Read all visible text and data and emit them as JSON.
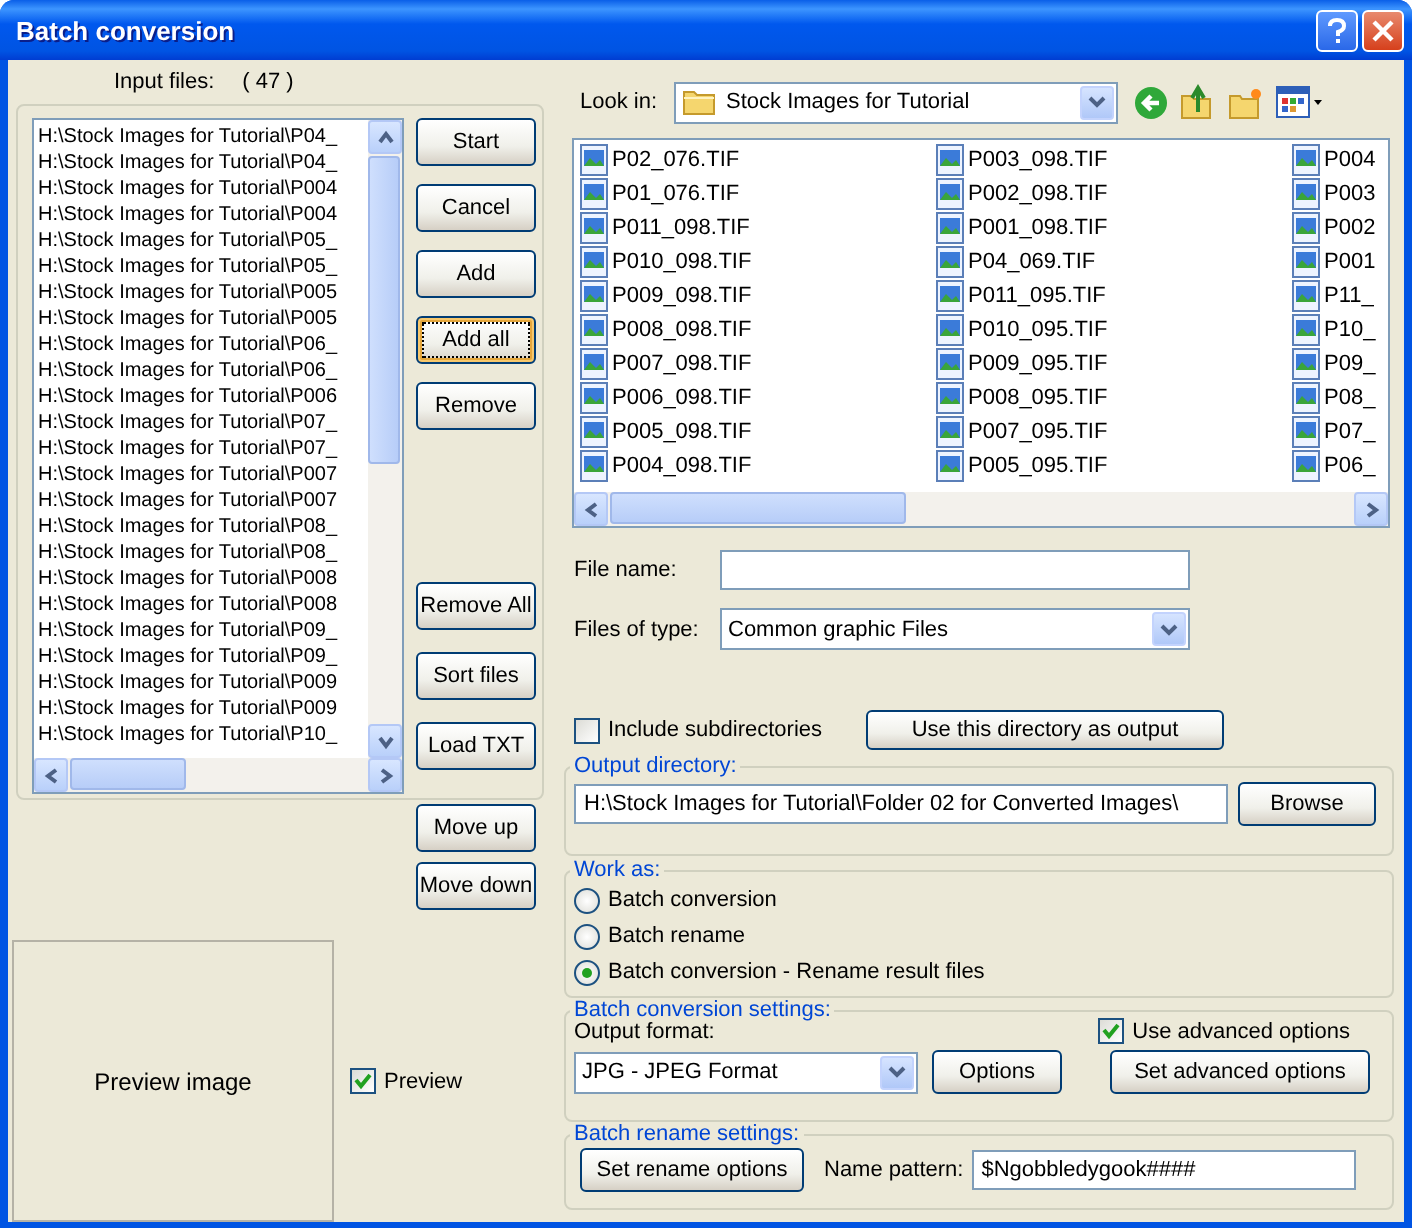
{
  "window": {
    "title": "Batch conversion"
  },
  "input_files": {
    "label": "Input files:",
    "count": "( 47 )",
    "items": [
      "H:\\Stock Images for Tutorial\\P04_",
      "H:\\Stock Images for Tutorial\\P04_",
      "H:\\Stock Images for Tutorial\\P004",
      "H:\\Stock Images for Tutorial\\P004",
      "H:\\Stock Images for Tutorial\\P05_",
      "H:\\Stock Images for Tutorial\\P05_",
      "H:\\Stock Images for Tutorial\\P005",
      "H:\\Stock Images for Tutorial\\P005",
      "H:\\Stock Images for Tutorial\\P06_",
      "H:\\Stock Images for Tutorial\\P06_",
      "H:\\Stock Images for Tutorial\\P006",
      "H:\\Stock Images for Tutorial\\P07_",
      "H:\\Stock Images for Tutorial\\P07_",
      "H:\\Stock Images for Tutorial\\P007",
      "H:\\Stock Images for Tutorial\\P007",
      "H:\\Stock Images for Tutorial\\P08_",
      "H:\\Stock Images for Tutorial\\P08_",
      "H:\\Stock Images for Tutorial\\P008",
      "H:\\Stock Images for Tutorial\\P008",
      "H:\\Stock Images for Tutorial\\P09_",
      "H:\\Stock Images for Tutorial\\P09_",
      "H:\\Stock Images for Tutorial\\P009",
      "H:\\Stock Images for Tutorial\\P009",
      "H:\\Stock Images for Tutorial\\P10_"
    ]
  },
  "top_buttons": [
    {
      "label": "Start",
      "focused": false
    },
    {
      "label": "Cancel",
      "focused": false
    },
    {
      "label": "Add",
      "focused": false
    },
    {
      "label": "Add all",
      "focused": true
    },
    {
      "label": "Remove",
      "focused": false
    }
  ],
  "bottom_buttons": [
    {
      "label": "Remove All",
      "focused": false
    },
    {
      "label": "Sort files",
      "focused": false
    },
    {
      "label": "Load TXT",
      "focused": false
    }
  ],
  "move_buttons": [
    {
      "label": "Move up",
      "focused": false
    },
    {
      "label": "Move down",
      "focused": false
    }
  ],
  "preview": {
    "text": "Preview image",
    "checkbox": {
      "label": "Preview",
      "checked": true
    }
  },
  "look_in": {
    "label": "Look in:",
    "value": "Stock Images for Tutorial"
  },
  "files": [
    "P02_076.TIF",
    "P01_076.TIF",
    "P011_098.TIF",
    "P010_098.TIF",
    "P009_098.TIF",
    "P008_098.TIF",
    "P007_098.TIF",
    "P006_098.TIF",
    "P005_098.TIF",
    "P004_098.TIF",
    "P003_098.TIF",
    "P002_098.TIF",
    "P001_098.TIF",
    "P04_069.TIF",
    "P011_095.TIF",
    "P010_095.TIF",
    "P009_095.TIF",
    "P008_095.TIF",
    "P007_095.TIF",
    "P005_095.TIF",
    "P004",
    "P003",
    "P002",
    "P001",
    "P11_",
    "P10_",
    "P09_",
    "P08_",
    "P07_",
    "P06_"
  ],
  "file_name": {
    "label": "File name:"
  },
  "files_of_type": {
    "label": "Files of type:",
    "value": "Common graphic Files"
  },
  "include_subdirectories": {
    "label": "Include subdirectories",
    "checked": false
  },
  "use_dir_button": "Use this directory as output",
  "output_directory": {
    "title": "Output directory:",
    "value": "H:\\Stock Images for Tutorial\\Folder 02 for Converted Images\\",
    "button": "Browse"
  },
  "work_as": {
    "title": "Work as:",
    "options": [
      {
        "label": "Batch conversion",
        "selected": false
      },
      {
        "label": "Batch rename",
        "selected": false
      },
      {
        "label": "Batch conversion - Rename result files",
        "selected": true
      }
    ]
  },
  "conversion_settings": {
    "title": "Batch conversion settings:",
    "format_label": "Output format:",
    "format": "JPG - JPEG Format",
    "options_button": "Options",
    "advanced": {
      "label": "Use advanced options",
      "checked": true
    },
    "advanced_button": "Set advanced options"
  },
  "rename_settings": {
    "title": "Batch rename settings:",
    "button": "Set rename options",
    "pattern_label": "Name pattern:",
    "pattern": "$Ngobbledygook####"
  }
}
